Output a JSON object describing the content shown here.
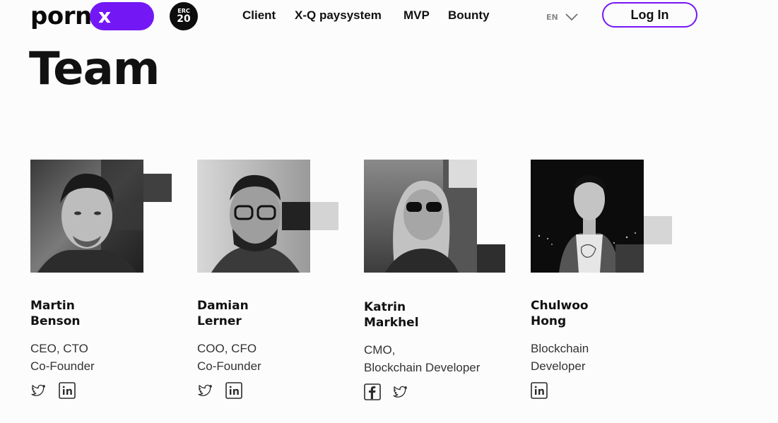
{
  "header": {
    "logo_text": "porn",
    "logo_pill_text": "x",
    "badge_top": "ERC",
    "badge_bottom": "20",
    "nav": [
      {
        "label": "Client"
      },
      {
        "label": "X-Q paysystem"
      },
      {
        "label": "MVP"
      },
      {
        "label": "Bounty"
      }
    ],
    "language": "EN",
    "login_label": "Log In"
  },
  "page_title": "Team",
  "colors": {
    "accent": "#7417f5",
    "text": "#111111",
    "background": "#fcfcfc"
  },
  "team": [
    {
      "first": "Martin",
      "last": "Benson",
      "role_line1": "CEO, CTO",
      "role_line2": "Co-Founder",
      "socials": [
        "twitter-icon",
        "linkedin-icon"
      ]
    },
    {
      "first": "Damian",
      "last": "Lerner",
      "role_line1": "COO, CFO",
      "role_line2": "Co-Founder",
      "socials": [
        "twitter-icon",
        "linkedin-icon"
      ]
    },
    {
      "first": "Katrin",
      "last": "Markhel",
      "role_line1": "CMO,",
      "role_line2": "Blockchain Developer",
      "socials": [
        "facebook-icon",
        "twitter-icon"
      ]
    },
    {
      "first": "Chulwoo",
      "last": "Hong",
      "role_line1": "Blockchain",
      "role_line2": "Developer",
      "socials": [
        "linkedin-icon"
      ]
    }
  ]
}
